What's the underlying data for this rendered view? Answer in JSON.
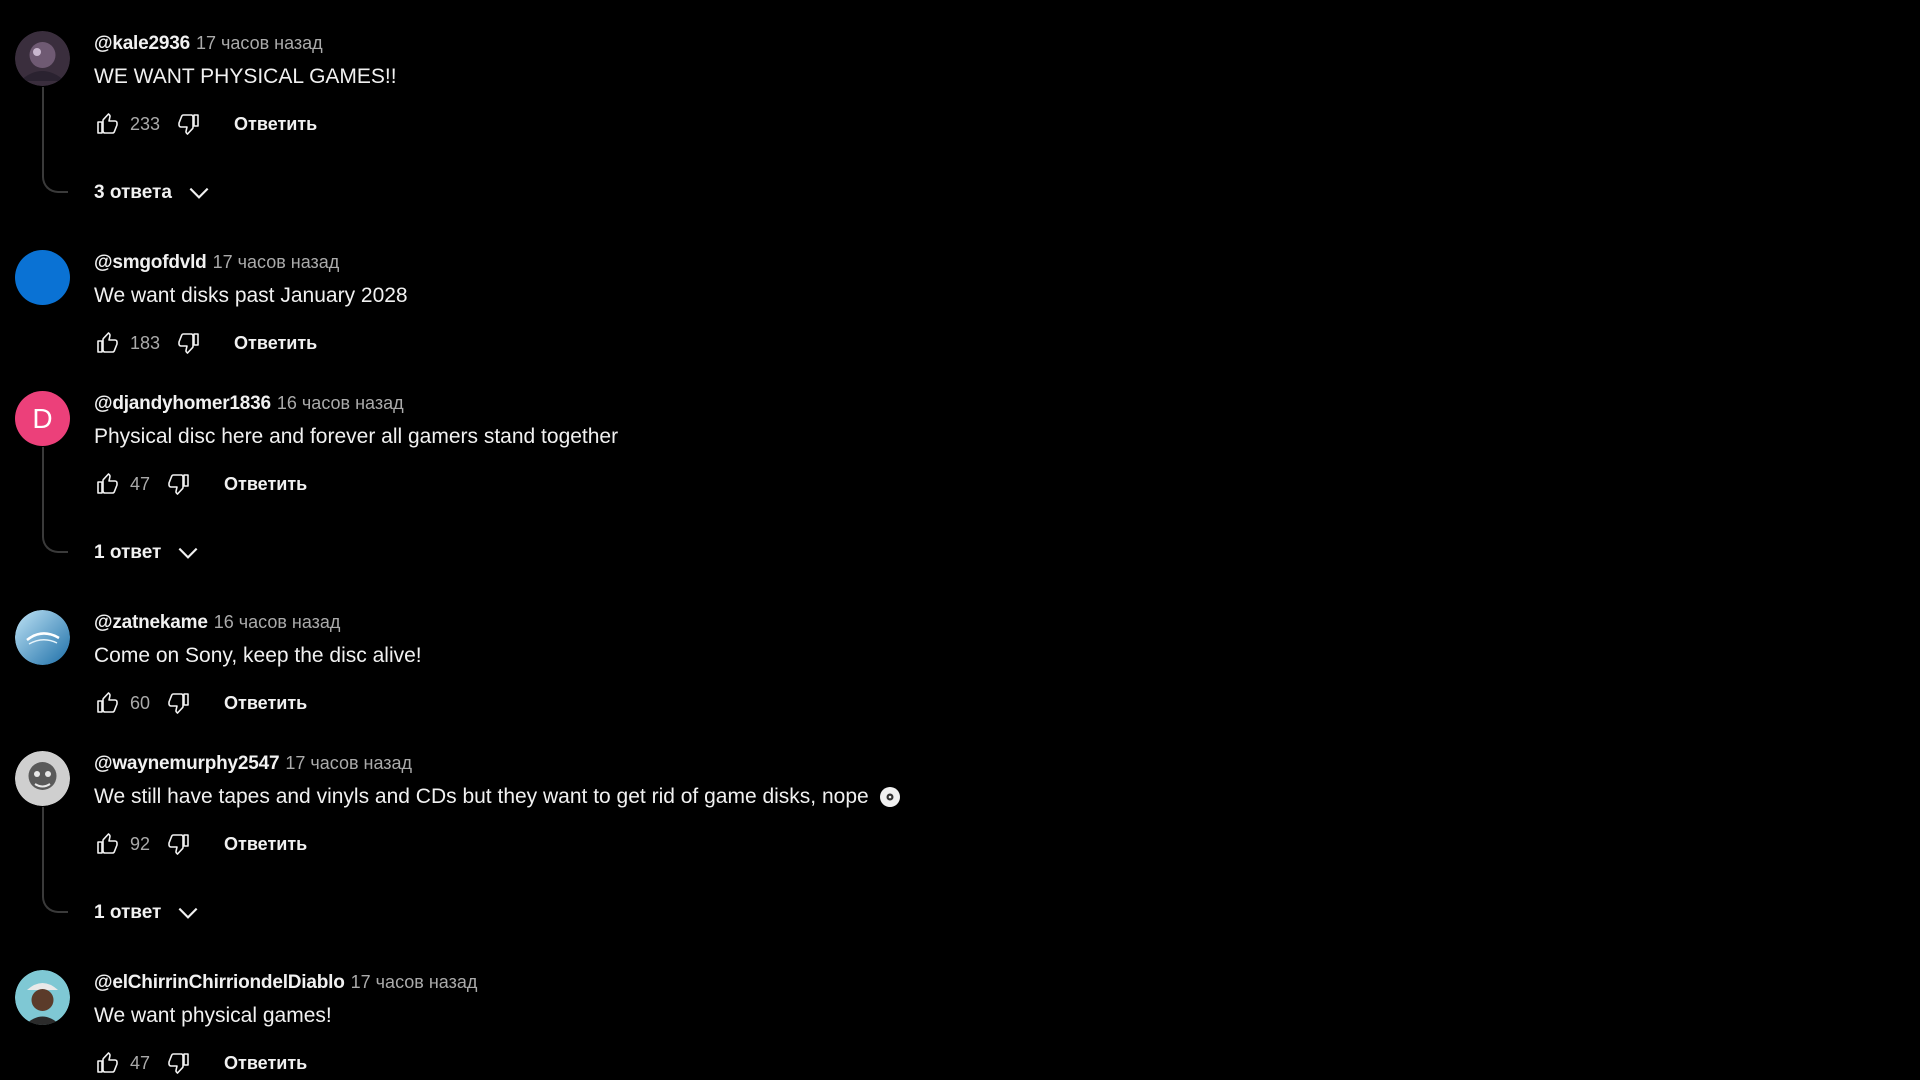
{
  "colors": {
    "background": "#000000",
    "text_primary": "#f1f1f1",
    "text_secondary": "#aaaaaa",
    "thread_line": "#3a3a3a"
  },
  "actions": {
    "reply_label": "Ответить",
    "like_icon": "thumb-up-icon",
    "dislike_icon": "thumb-down-icon",
    "expand_icon": "chevron-down-icon"
  },
  "comments": [
    {
      "author": "@kale2936",
      "time": "17 часов назад",
      "text": "WE WANT PHYSICAL GAMES!!",
      "likes": "233",
      "avatar": {
        "type": "image",
        "icon": "avatar-photo-icon",
        "color": "#5a4658"
      },
      "replies_label": "3 ответа"
    },
    {
      "author": "@smgofdvld",
      "time": "17 часов назад",
      "text": "We want disks past January 2028",
      "likes": "183",
      "avatar": {
        "type": "solid",
        "color": "#0a72d4"
      }
    },
    {
      "author": "@djandyhomer1836",
      "time": "16 часов назад",
      "text": "Physical disc here and forever all gamers stand together",
      "likes": "47",
      "avatar": {
        "type": "letter",
        "letter": "D",
        "color": "#ec407a"
      },
      "replies_label": "1 ответ"
    },
    {
      "author": "@zatnekame",
      "time": "16 часов назад",
      "text": "Come on Sony, keep the disc alive!",
      "likes": "60",
      "avatar": {
        "type": "image",
        "icon": "avatar-photo-icon",
        "color": "#3d8fc4"
      }
    },
    {
      "author": "@waynemurphy2547",
      "time": "17 часов назад",
      "text": "We still have tapes and vinyls and CDs but they want to get rid of game disks, nope",
      "text_emoji": "disc-icon",
      "likes": "92",
      "avatar": {
        "type": "image",
        "icon": "avatar-photo-icon",
        "color": "#8a8a8a"
      },
      "replies_label": "1 ответ"
    },
    {
      "author": "@elChirrinChirriondelDiablo",
      "time": "17 часов назад",
      "text": "We want physical games!",
      "likes": "47",
      "avatar": {
        "type": "image",
        "icon": "avatar-photo-icon",
        "color": "#4fb0c0"
      }
    }
  ]
}
